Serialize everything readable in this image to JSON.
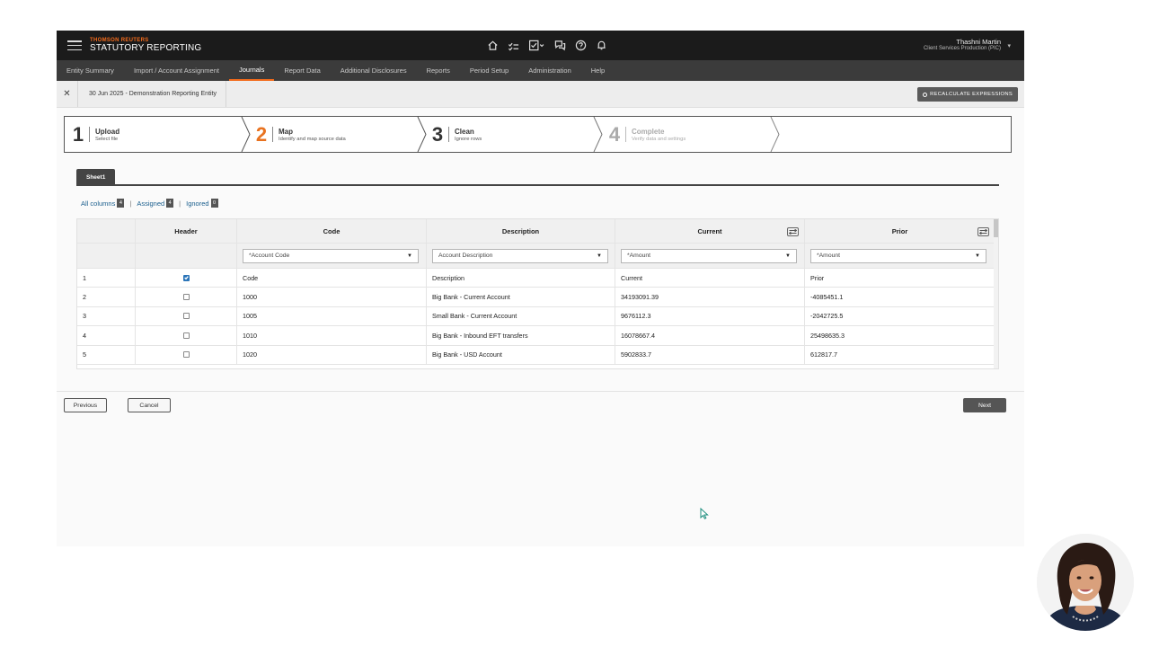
{
  "header": {
    "brand_top": "THOMSON REUTERS",
    "brand_bottom": "STATUTORY REPORTING",
    "icons": [
      "home-icon",
      "tasks-icon",
      "checklist-icon",
      "chat-icon",
      "help-icon",
      "bell-icon"
    ],
    "user_name": "Thashni Martin",
    "user_org": "Client Services Production (PIC)"
  },
  "nav": {
    "items": [
      "Entity Summary",
      "Import / Account Assignment",
      "Journals",
      "Report Data",
      "Additional Disclosures",
      "Reports",
      "Period Setup",
      "Administration",
      "Help"
    ],
    "active": "Journals"
  },
  "entity": {
    "label": "30 Jun 2025 - Demonstration Reporting Entity",
    "recalc_label": "RECALCULATE EXPRESSIONS"
  },
  "steps": [
    {
      "num": "1",
      "title": "Upload",
      "sub": "Select file",
      "state": "done"
    },
    {
      "num": "2",
      "title": "Map",
      "sub": "Identify and map source data",
      "state": "active"
    },
    {
      "num": "3",
      "title": "Clean",
      "sub": "Ignore rows",
      "state": "pending"
    },
    {
      "num": "4",
      "title": "Complete",
      "sub": "Verify data and settings",
      "state": "disabled"
    }
  ],
  "sheet_tab": "Sheet1",
  "filters": {
    "all_label": "All columns",
    "all_count": "4",
    "assigned_label": "Assigned",
    "assigned_count": "4",
    "ignored_label": "Ignored",
    "ignored_count": "0"
  },
  "table": {
    "headers": [
      "",
      "Header",
      "Code",
      "Description",
      "Current",
      "Prior"
    ],
    "mappings": [
      "*Account Code",
      "Account Description",
      "*Amount",
      "*Amount"
    ],
    "rows": [
      {
        "n": "1",
        "header": true,
        "code": "Code",
        "desc": "Description",
        "current": "Current",
        "prior": "Prior"
      },
      {
        "n": "2",
        "header": false,
        "code": "1000",
        "desc": "Big Bank - Current Account",
        "current": "34193091.39",
        "prior": "-4085451.1"
      },
      {
        "n": "3",
        "header": false,
        "code": "1005",
        "desc": "Small Bank - Current Account",
        "current": "9676112.3",
        "prior": "-2042725.5"
      },
      {
        "n": "4",
        "header": false,
        "code": "1010",
        "desc": "Big Bank - Inbound EFT transfers",
        "current": "16078667.4",
        "prior": "25498635.3"
      },
      {
        "n": "5",
        "header": false,
        "code": "1020",
        "desc": "Big Bank - USD Account",
        "current": "5902833.7",
        "prior": "612817.7"
      }
    ]
  },
  "buttons": {
    "previous": "Previous",
    "cancel": "Cancel",
    "next": "Next"
  },
  "colors": {
    "accent": "#f26a1b",
    "link": "#1a5e8d",
    "checkbox": "#2a74b8"
  }
}
